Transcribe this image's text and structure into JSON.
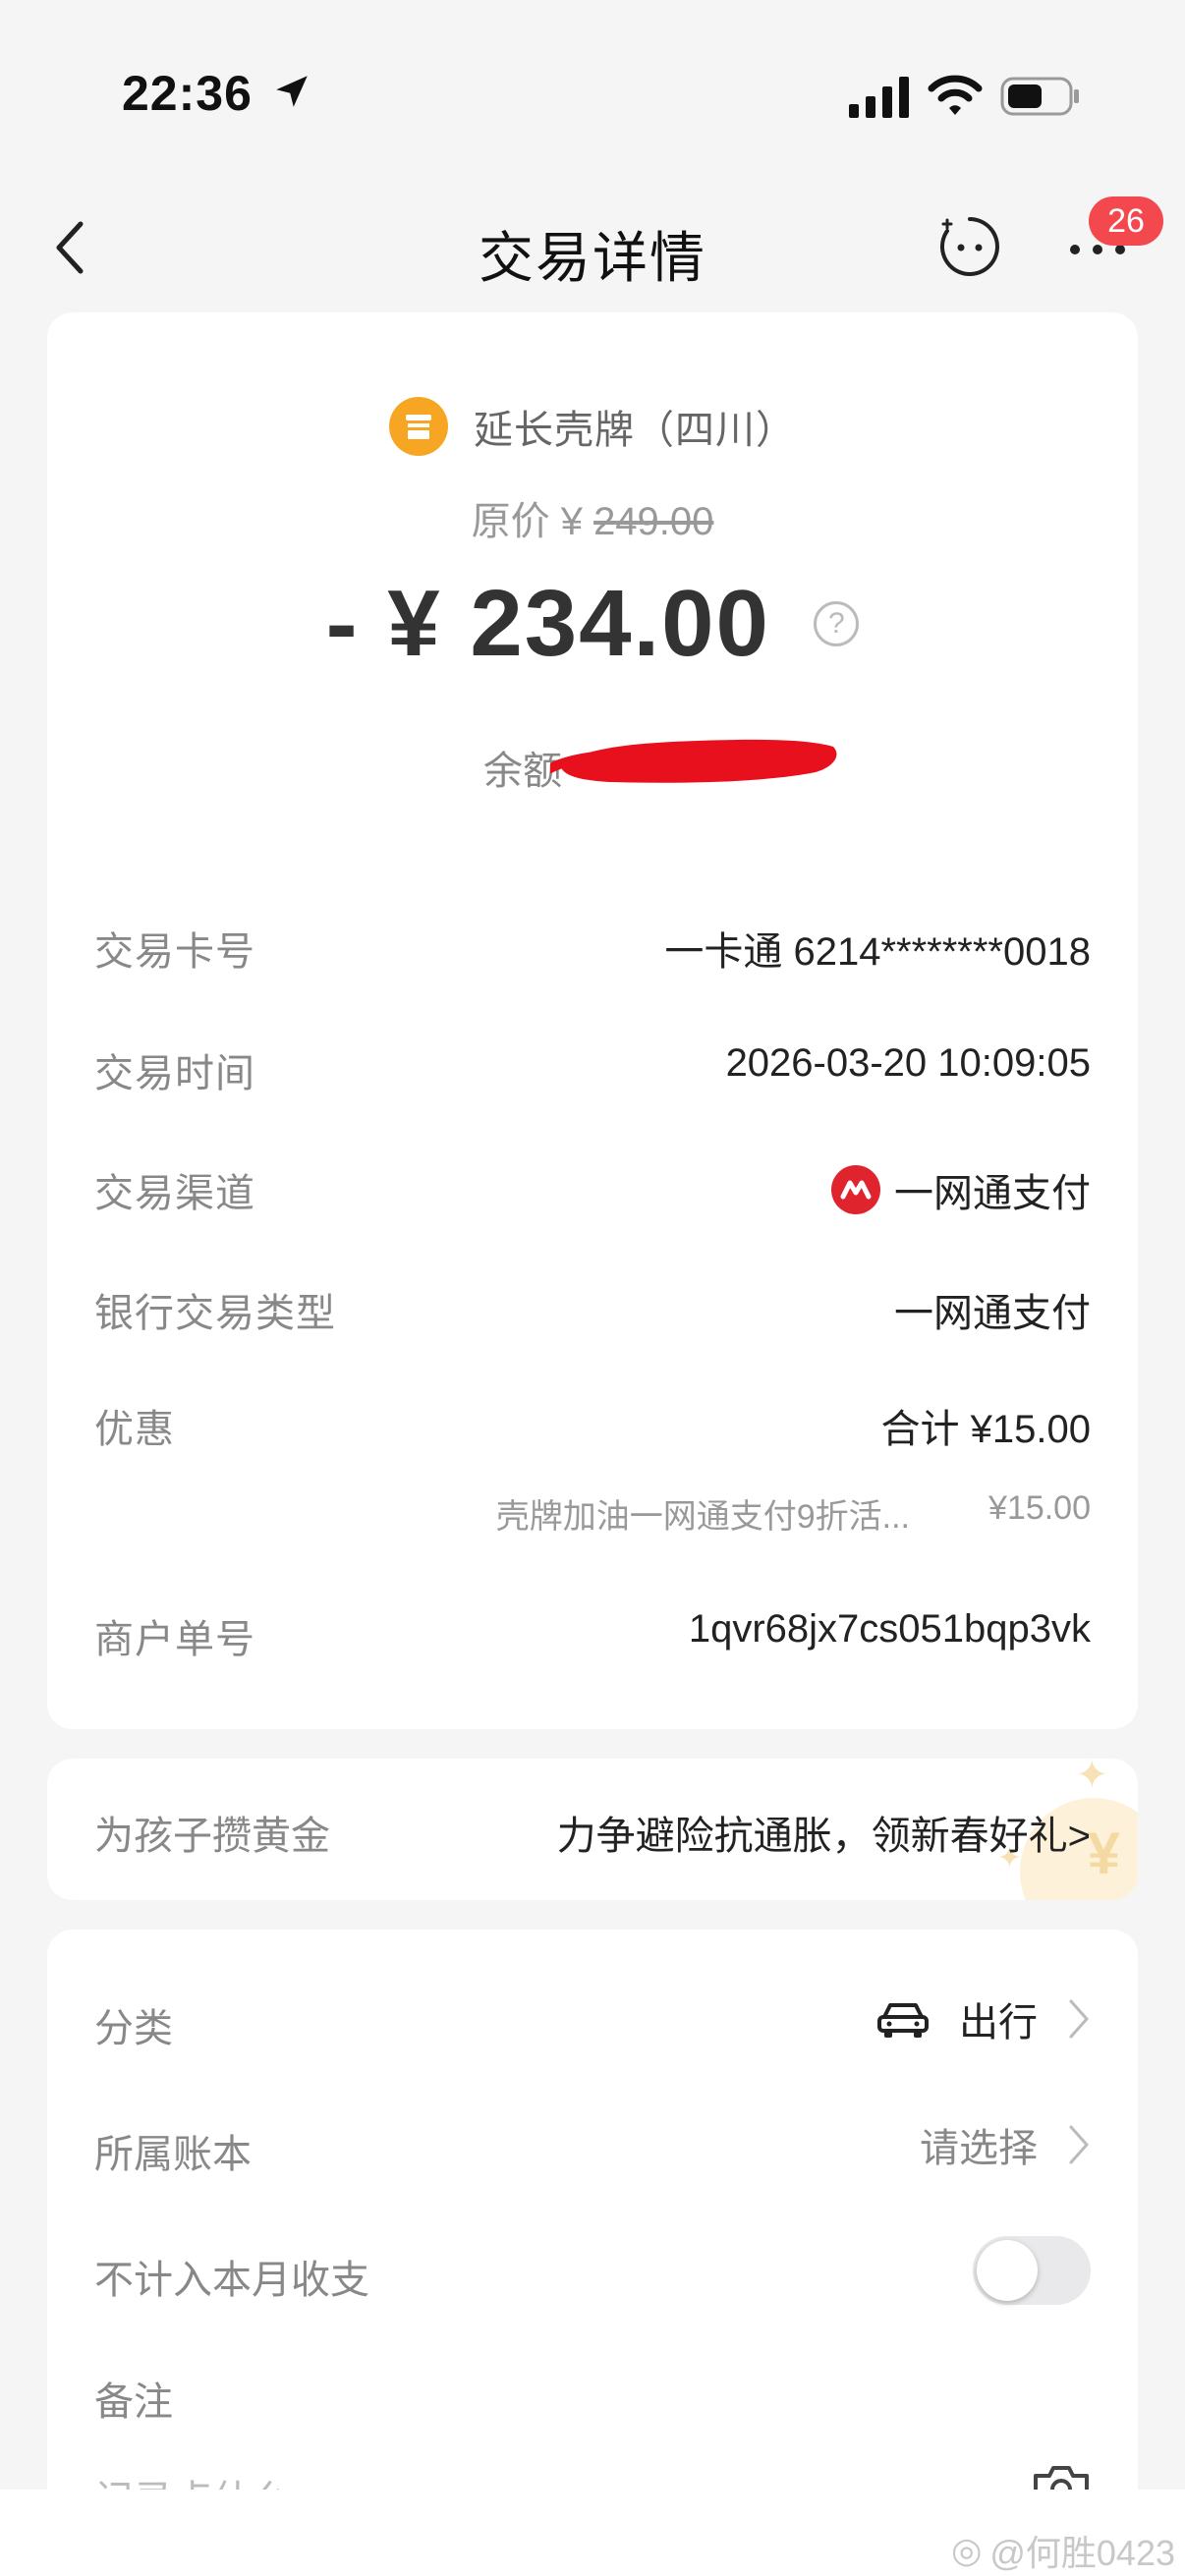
{
  "status_bar": {
    "time": "22:36"
  },
  "nav": {
    "title": "交易详情",
    "badge": "26"
  },
  "merchant": {
    "name": "延长壳牌（四川）",
    "original_price_label": "原价 ¥ ",
    "original_price": "249.00",
    "amount": "- ¥ 234.00",
    "help": "?",
    "balance_label": "余额"
  },
  "details": [
    {
      "label": "交易卡号",
      "value": "一卡通 6214********0018"
    },
    {
      "label": "交易时间",
      "value": "2026-03-20 10:09:05"
    },
    {
      "label": "交易渠道",
      "value": "一网通支付"
    },
    {
      "label": "银行交易类型",
      "value": "一网通支付"
    },
    {
      "label": "优惠",
      "value": "合计  ¥15.00"
    },
    {
      "label": "商户单号",
      "value": "1qvr68jx7cs051bqp3vk"
    }
  ],
  "discount_item": {
    "desc": "壳牌加油一网通支付9折活...",
    "amount": "¥15.00"
  },
  "promo": {
    "label": "为孩子攒黄金",
    "value": "力争避险抗通胀，领新春好礼>",
    "deco": "¥"
  },
  "settings": {
    "category": {
      "label": "分类",
      "value": "出行"
    },
    "ledger": {
      "label": "所属账本",
      "value": "请选择"
    },
    "exclude": {
      "label": "不计入本月收支",
      "enabled": false
    },
    "note": {
      "label": "备注"
    },
    "cut": {
      "label": "记录点什么"
    }
  },
  "watermark": "@何胜0423",
  "colors": {
    "accent": "#f2484e",
    "merchant_icon": "#f6a623",
    "channel_icon": "#e0242e",
    "mask": "#e8101d"
  }
}
